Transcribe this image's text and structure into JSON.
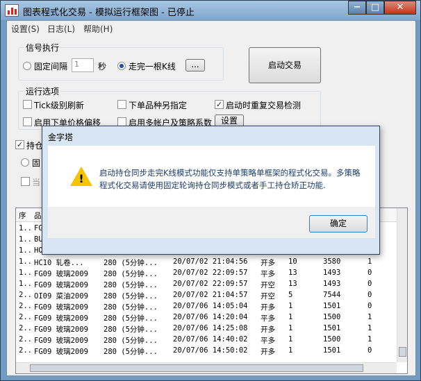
{
  "window": {
    "title": "图表程式化交易 - 模拟运行框架图 - 已停止",
    "controls": {
      "minimize": "−",
      "maximize": "□",
      "close": "✕"
    }
  },
  "menu": [
    "设置(S)",
    "日志(L)",
    "帮助(H)"
  ],
  "signal": {
    "group_title": "信号执行",
    "fixed_interval_label": "固定间隔",
    "interval_value": "1",
    "seconds_label": "秒",
    "bar_complete_label": "走完一根K线",
    "more_button": "...",
    "selected": "bar_complete"
  },
  "start_button": "启动交易",
  "options": {
    "group_title": "运行选项",
    "tick_refresh": "Tick级别刷新",
    "order_variety": "下单品种另指定",
    "restart_check": "启动时重复交易检测",
    "restart_check_checked": true,
    "price_offset": "启用下单价格偏移",
    "multi_account": "启用多帐户及策略系数",
    "settings_button": "设置"
  },
  "position_sync": {
    "label": "持仓",
    "checked": true,
    "fixed_label": "固",
    "current_label": "当"
  },
  "grid": {
    "headers": [
      "序",
      "品",
      "",
      "",
      "",
      "",
      "",
      ""
    ],
    "rows": [
      [
        "1..",
        "FG",
        "",
        "",
        "",
        "",
        "",
        ""
      ],
      [
        "1..",
        "BU",
        "",
        "",
        "",
        "",
        "",
        ""
      ],
      [
        "1..",
        "HO",
        "",
        "",
        "",
        "",
        "",
        ""
      ],
      [
        "1..",
        "HC10 轧卷...",
        "280 (5分钟...",
        "20/07/02 21:04:56",
        "开多",
        "10",
        "3580",
        "1"
      ],
      [
        "1..",
        "FG09 玻璃2009",
        "280 (5分钟...",
        "20/07/02 22:09:57",
        "平多",
        "13",
        "1493",
        "0"
      ],
      [
        "1..",
        "FG09 玻璃2009",
        "280 (5分钟...",
        "20/07/02 22:09:57",
        "开空",
        "13",
        "1493",
        "0"
      ],
      [
        "2..",
        "OI09 菜油2009",
        "280 (5分钟...",
        "20/07/02 21:04:57",
        "开空",
        "5",
        "7544",
        "0"
      ],
      [
        "2..",
        "FG09 玻璃2009",
        "280 (5分钟...",
        "20/07/06 14:05:04",
        "开多",
        "1",
        "1501",
        "0"
      ],
      [
        "2..",
        "FG09 玻璃2009",
        "280 (5分钟...",
        "20/07/06 14:20:04",
        "平多",
        "1",
        "1500",
        "1"
      ],
      [
        "2..",
        "FG09 玻璃2009",
        "280 (5分钟...",
        "20/07/06 14:25:08",
        "开多",
        "1",
        "1501",
        "1"
      ],
      [
        "2..",
        "FG09 玻璃2009",
        "280 (5分钟...",
        "20/07/06 14:40:02",
        "平多",
        "1",
        "1500",
        "1"
      ],
      [
        "2..",
        "FG09 玻璃2009",
        "280 (5分钟...",
        "20/07/06 14:50:02",
        "开多",
        "1",
        "1501",
        "0"
      ]
    ]
  },
  "dialog": {
    "title": "金字塔",
    "message": "启动持仓同步走完K线模式功能仅支持单策略单框架的程式化交易。多策略程式化交易请使用固定轮询持仓同步模式或者手工持仓矫正功能.",
    "icon": "warning-icon",
    "ok_button": "确定"
  },
  "colors": {
    "title_bar": "#8fb1d4",
    "close_button": "#c2331d",
    "dialog_text": "#1c3c6c",
    "warning": "#f5c400"
  }
}
